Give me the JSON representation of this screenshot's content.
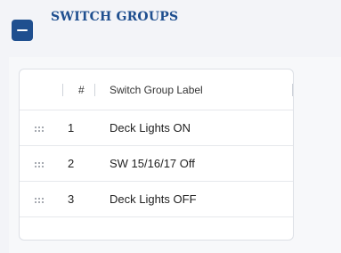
{
  "header": {
    "title": "SWITCH GROUPS",
    "collapse_icon": "minus-icon",
    "accent": "#1f4f8f"
  },
  "table": {
    "columns": [
      "#",
      "Switch Group Label"
    ],
    "rows": [
      {
        "num": "1",
        "label": "Deck Lights ON"
      },
      {
        "num": "2",
        "label": "SW 15/16/17 Off"
      },
      {
        "num": "3",
        "label": "Deck Lights OFF"
      }
    ],
    "row_handle_icon": "drag-handle-icon"
  }
}
